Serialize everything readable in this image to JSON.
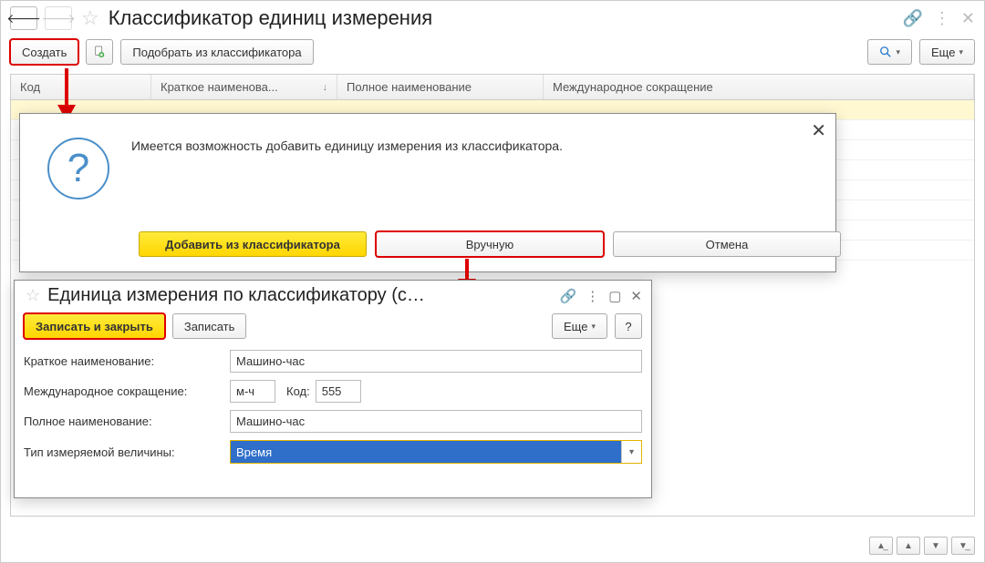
{
  "mainWindow": {
    "title": "Классификатор единиц измерения"
  },
  "toolbar": {
    "create": "Создать",
    "pick_from_classifier": "Подобрать из классификатора",
    "more": "Еще"
  },
  "tableHeaders": {
    "code": "Код",
    "short_name": "Краткое наименова...",
    "full_name": "Полное наименование",
    "intl_abbrev": "Международное сокращение"
  },
  "dialog1": {
    "message": "Имеется возможность добавить единицу измерения из классификатора.",
    "btn_add": "Добавить из классификатора",
    "btn_manual": "Вручную",
    "btn_cancel": "Отмена"
  },
  "dialog2": {
    "title": "Единица измерения по классификатору (с…",
    "btn_save_close": "Записать и закрыть",
    "btn_save": "Записать",
    "btn_more": "Еще",
    "btn_help": "?",
    "labels": {
      "short_name": "Краткое наименование:",
      "intl_abbrev": "Международное сокращение:",
      "code": "Код:",
      "full_name": "Полное наименование:",
      "measure_type": "Тип измеряемой величины:"
    },
    "values": {
      "short_name": "Машино-час",
      "intl_abbrev": "м-ч",
      "code": "555",
      "full_name": "Машино-час",
      "measure_type": "Время"
    }
  }
}
